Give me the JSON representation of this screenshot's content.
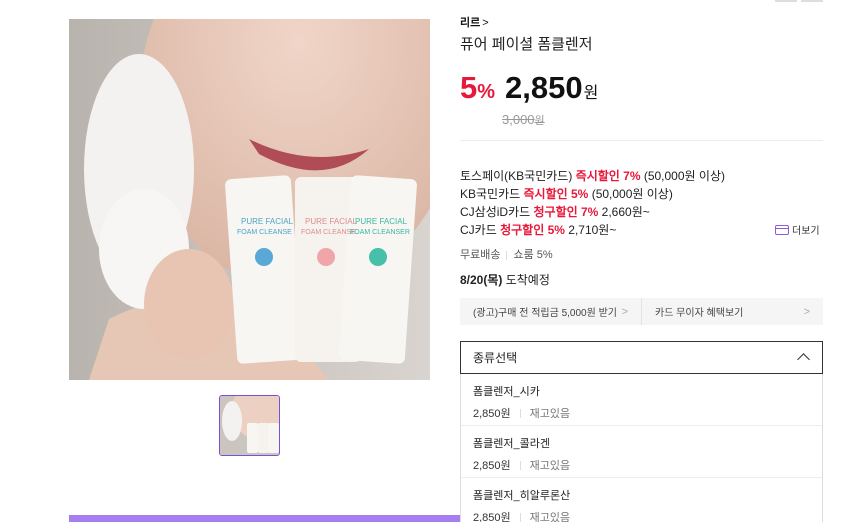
{
  "product": {
    "brand": "리르",
    "name": "퓨어 페이셜 폼클렌저",
    "discount": "5",
    "discount_unit": "%",
    "price": "2,850",
    "price_unit": "원",
    "original_price": "3,000",
    "original_unit": "원"
  },
  "benefits": [
    {
      "pre": "토스페이(KB국민카드) ",
      "hl": "즉시할인 7%",
      "post": " (50,000원 이상)"
    },
    {
      "pre": "KB국민카드 ",
      "hl": "즉시할인 5%",
      "post": " (50,000원 이상)"
    },
    {
      "pre": "CJ삼성iD카드 ",
      "hl": "청구할인 7%",
      "post": " 2,660원~"
    },
    {
      "pre": "CJ카드 ",
      "hl": "청구할인 5%",
      "post": " 2,710원~"
    }
  ],
  "more_label": "더보기",
  "shipping": {
    "free": "무료배송",
    "points": "쇼룸 5%"
  },
  "arrival": {
    "date": "8/20(목)",
    "text": " 도착예정"
  },
  "promos": [
    {
      "label": "(광고)구매 전 적립금 5,000원 받기"
    },
    {
      "label": "카드 무이자 혜택보기"
    }
  ],
  "select": {
    "label": "종류선택"
  },
  "options": [
    {
      "name": "폼클렌저_시카",
      "price": "2,850원",
      "stock": "재고있음"
    },
    {
      "name": "폼클렌저_콜라겐",
      "price": "2,850원",
      "stock": "재고있음"
    },
    {
      "name": "폼클렌저_히알루론산",
      "price": "2,850원",
      "stock": "재고있음"
    }
  ],
  "colors": {
    "accent": "#e8183a",
    "brand_purple": "#a57ff0"
  },
  "icons": [
    "chevron-right-icon",
    "card-icon",
    "chevron-up-icon"
  ]
}
